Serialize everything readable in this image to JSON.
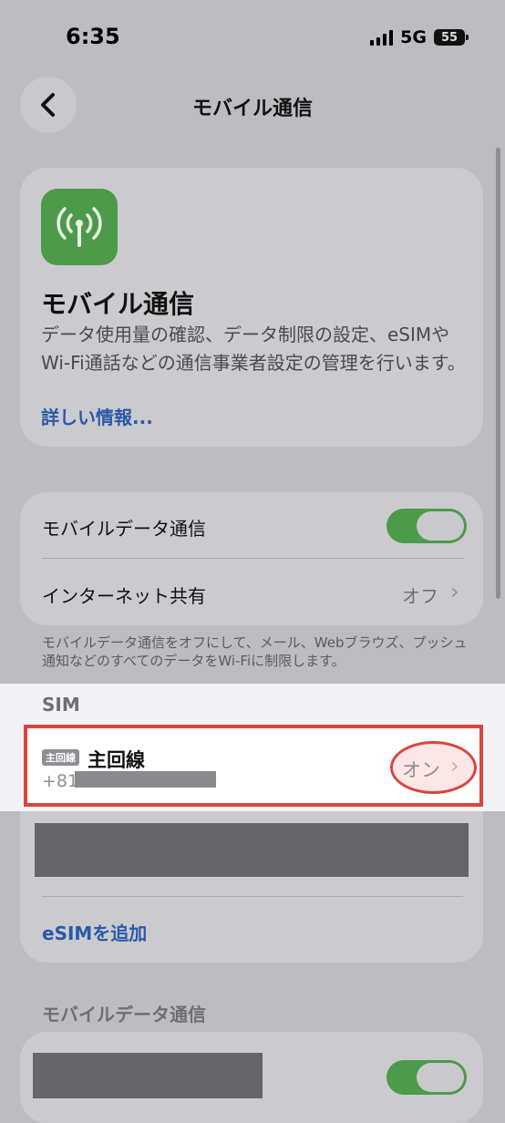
{
  "status": {
    "time": "6:35",
    "network": "5G",
    "battery": "55"
  },
  "nav": {
    "title": "モバイル通信"
  },
  "intro": {
    "title": "モバイル通信",
    "description": "データ使用量の確認、データ制限の設定、eSIMやWi-Fi通話などの通信事業者設定の管理を行います。",
    "link": "詳しい情報..."
  },
  "settings": {
    "mobile_data_label": "モバイルデータ通信",
    "mobile_data_on": true,
    "hotspot_label": "インターネット共有",
    "hotspot_value": "オフ",
    "footnote": "モバイルデータ通信をオフにして、メール、Webブラウズ、プッシュ通知などのすべてのデータをWi-Fiに制限します。"
  },
  "sim": {
    "header": "SIM",
    "badge": "主回線",
    "name": "主回線",
    "number_prefix": "+81",
    "status": "オン",
    "add_esim": "eSIMを追加"
  },
  "section2": {
    "header": "モバイルデータ通信",
    "toggle_on": true
  },
  "colors": {
    "accent_green": "#4c9a4a",
    "link_blue": "#2a5aa8",
    "highlight_red": "#d9453b"
  }
}
